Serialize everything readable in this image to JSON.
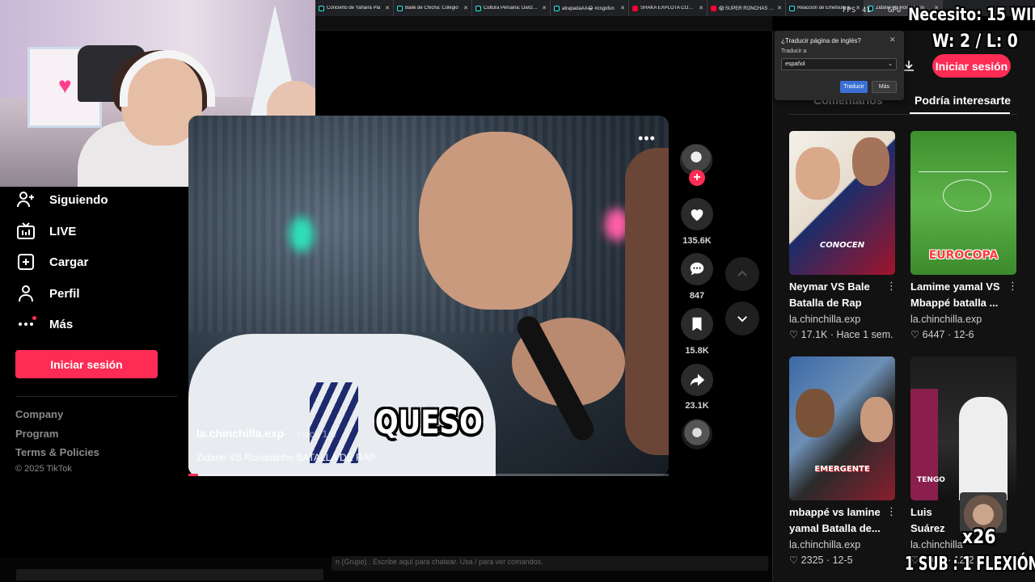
{
  "browser": {
    "tabs": [
      {
        "title": "Concierto de Yahaira Pla",
        "favicon": "tiktok"
      },
      {
        "title": "Baile de Chicha: Colegio",
        "favicon": "tiktok"
      },
      {
        "title": "Cultura Peruana: Danza C",
        "favicon": "tiktok"
      },
      {
        "title": "atrapadaAA😂 #csgofun",
        "favicon": "tiktok"
      },
      {
        "title": "SHAKA EXPLOTA CON KI",
        "favicon": "youtube"
      },
      {
        "title": "😱 SUPER RONCHAS EN",
        "favicon": "youtube"
      },
      {
        "title": "Reacción de Emetsuki a",
        "favicon": "tiktok"
      },
      {
        "title": "Zidane VS Ronaldinho",
        "favicon": "tiktok"
      }
    ],
    "fps_label": "FPS",
    "fps_value": "41",
    "gpu_label": "GPU"
  },
  "translate_popup": {
    "title": "¿Traducir página de inglés?",
    "label": "Traducir a",
    "selected_language": "español",
    "translate_button": "Traducir",
    "more_button": "Más"
  },
  "sidebar": {
    "items": [
      {
        "label": "Siguiendo",
        "icon": "following-icon"
      },
      {
        "label": "LIVE",
        "icon": "live-icon"
      },
      {
        "label": "Cargar",
        "icon": "upload-icon"
      },
      {
        "label": "Perfil",
        "icon": "profile-icon"
      },
      {
        "label": "Más",
        "icon": "more-icon"
      }
    ],
    "login_button": "Iniciar sesión",
    "footer_links": [
      "Company",
      "Program",
      "Terms & Policies"
    ],
    "copyright": "© 2025 TikTok"
  },
  "video": {
    "caption": "QUESO",
    "author": "la.chinchilla.exp",
    "date": "· Hace 1 d",
    "description": "Zidane VS Ronaldinho BATALLA DE RAP",
    "progress": 0.02,
    "actions": {
      "likes": "135.6K",
      "comments": "847",
      "saves": "15.8K",
      "shares": "23.1K"
    }
  },
  "header": {
    "login_button": "Iniciar sesión"
  },
  "right_panel": {
    "tabs": {
      "comments": "Comentarios",
      "related": "Podría interesarte"
    },
    "cards": [
      {
        "title": "Neymar VS Bale Batalla de Rap",
        "thumb_text": "CONOCEN",
        "author": "la.chinchilla.exp",
        "meta": "♡ 17.1K · Hace 1 sem."
      },
      {
        "title": "Lamime yamal VS Mbappé batalla ...",
        "thumb_text": "EUROCOPA",
        "author": "la.chinchilla.exp",
        "meta": "♡ 6447 · 12-6"
      },
      {
        "title": "mbappé vs lamine yamal Batalla de...",
        "thumb_text": "EMERGENTE",
        "author": "la.chinchilla.exp",
        "meta": "♡ 2325 · 12-5"
      },
      {
        "title": "Luis Suárez Benzema",
        "thumb_text": "TENGO",
        "author": "la.chinchilla",
        "meta": "♡ 2015 · 12-2"
      }
    ]
  },
  "overlay": {
    "wins_goal": "Necesito: 15 WINS",
    "record": "W: 2 / L: 0",
    "multiplier": "x26",
    "sub_rule": "1 SUB : 1 FLEXIÓN"
  },
  "bottom": {
    "chat_hint": "n (Grupo) . Escribe aquí para chatear. Usa / para ver comandos."
  }
}
